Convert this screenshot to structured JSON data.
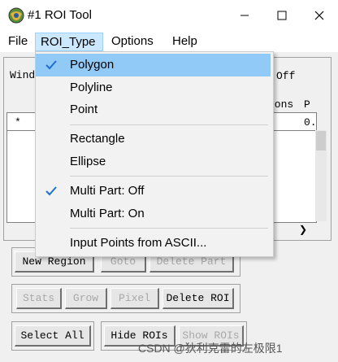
{
  "window": {
    "title": "#1 ROI Tool"
  },
  "menubar": {
    "items": [
      "File",
      "ROI_Type",
      "Options",
      "Help"
    ]
  },
  "background": {
    "window_label": "Wind",
    "off_label": "Off",
    "table": {
      "col_polygons": "gons",
      "col_p": "P",
      "row_marker": "*",
      "cell_value": "0."
    },
    "buttons": {
      "new_region": "New Region",
      "goto": "Goto",
      "delete_part": "Delete Part",
      "stats": "Stats",
      "grow": "Grow",
      "pixel": "Pixel",
      "delete_roi": "Delete ROI",
      "select_all": "Select All",
      "hide_rois": "Hide ROIs",
      "show_rois": "Show ROIs"
    }
  },
  "dropdown": {
    "items": [
      {
        "label": "Polygon",
        "checked": true,
        "highlighted": true
      },
      {
        "label": "Polyline",
        "checked": false
      },
      {
        "label": "Point",
        "checked": false
      },
      {
        "label": "Rectangle",
        "checked": false
      },
      {
        "label": "Ellipse",
        "checked": false
      },
      {
        "label": "Multi Part: Off",
        "checked": true
      },
      {
        "label": "Multi Part: On",
        "checked": false
      },
      {
        "label": "Input Points from ASCII...",
        "checked": false
      }
    ]
  },
  "watermark": "CSDN @狄利克雷的左极限1",
  "colors": {
    "highlight": "#91c9f7",
    "check": "#1e6fd0",
    "menu_active": "#cce8ff"
  }
}
